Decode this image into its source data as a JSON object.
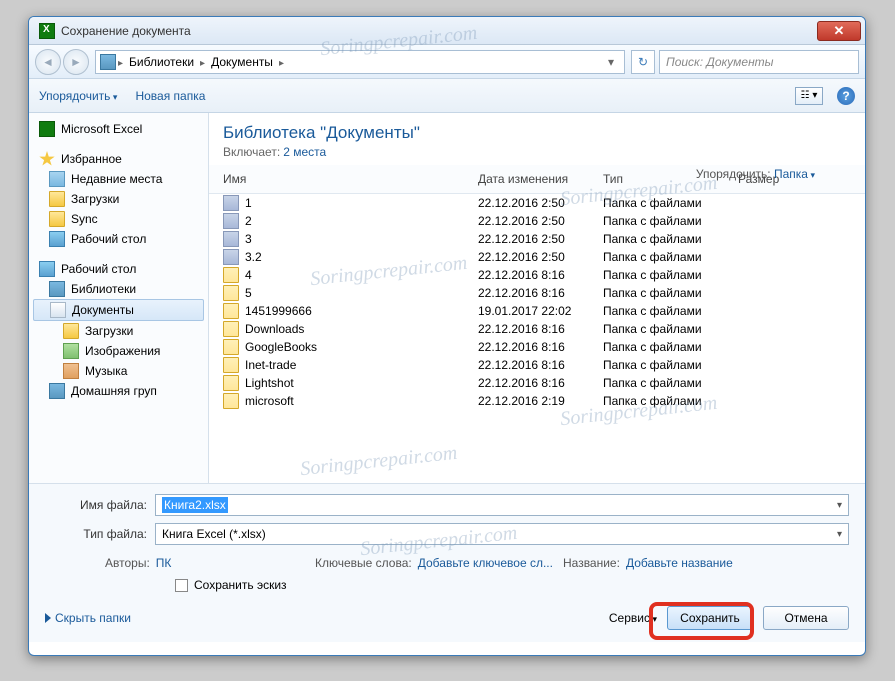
{
  "window": {
    "title": "Сохранение документа"
  },
  "breadcrumbs": [
    "Библиотеки",
    "Документы"
  ],
  "search": {
    "placeholder": "Поиск: Документы"
  },
  "toolbar": {
    "organize": "Упорядочить",
    "newfolder": "Новая папка"
  },
  "sidebar": {
    "app": "Microsoft Excel",
    "fav": "Избранное",
    "recent": "Недавние места",
    "downloads": "Загрузки",
    "sync": "Sync",
    "desktop1": "Рабочий стол",
    "desktop2": "Рабочий стол",
    "libraries": "Библиотеки",
    "documents": "Документы",
    "downloads2": "Загрузки",
    "images": "Изображения",
    "music": "Музыка",
    "homegroup": "Домашняя груп"
  },
  "header": {
    "title": "Библиотека \"Документы\"",
    "includes_label": "Включает:",
    "includes_link": "2 места",
    "sort_label": "Упорядочить:",
    "sort_value": "Папка"
  },
  "columns": {
    "name": "Имя",
    "date": "Дата изменения",
    "type": "Тип",
    "size": "Размер"
  },
  "files": [
    {
      "icon": "stack",
      "name": "1",
      "date": "22.12.2016 2:50",
      "type": "Папка с файлами"
    },
    {
      "icon": "stack",
      "name": "2",
      "date": "22.12.2016 2:50",
      "type": "Папка с файлами"
    },
    {
      "icon": "stack",
      "name": "3",
      "date": "22.12.2016 2:50",
      "type": "Папка с файлами"
    },
    {
      "icon": "stack",
      "name": "3.2",
      "date": "22.12.2016 2:50",
      "type": "Папка с файлами"
    },
    {
      "icon": "folder",
      "name": "4",
      "date": "22.12.2016 8:16",
      "type": "Папка с файлами"
    },
    {
      "icon": "folder",
      "name": "5",
      "date": "22.12.2016 8:16",
      "type": "Папка с файлами"
    },
    {
      "icon": "folder",
      "name": "1451999666",
      "date": "19.01.2017 22:02",
      "type": "Папка с файлами"
    },
    {
      "icon": "folder",
      "name": "Downloads",
      "date": "22.12.2016 8:16",
      "type": "Папка с файлами"
    },
    {
      "icon": "folder",
      "name": "GoogleBooks",
      "date": "22.12.2016 8:16",
      "type": "Папка с файлами"
    },
    {
      "icon": "folder",
      "name": "Inet-trade",
      "date": "22.12.2016 8:16",
      "type": "Папка с файлами"
    },
    {
      "icon": "folder",
      "name": "Lightshot",
      "date": "22.12.2016 8:16",
      "type": "Папка с файлами"
    },
    {
      "icon": "folder",
      "name": "microsoft",
      "date": "22.12.2016 2:19",
      "type": "Папка с файлами"
    }
  ],
  "form": {
    "filename_label": "Имя файла:",
    "filename_value": "Книга2.xlsx",
    "filetype_label": "Тип файла:",
    "filetype_value": "Книга Excel (*.xlsx)",
    "authors_label": "Авторы:",
    "authors_value": "ПК",
    "keywords_label": "Ключевые слова:",
    "keywords_value": "Добавьте ключевое сл...",
    "title_label": "Название:",
    "title_value": "Добавьте название",
    "thumb": "Сохранить эскиз"
  },
  "buttons": {
    "hide": "Скрыть папки",
    "service": "Сервис",
    "save": "Сохранить",
    "cancel": "Отмена"
  },
  "watermark": "Soringpcrepair.com"
}
